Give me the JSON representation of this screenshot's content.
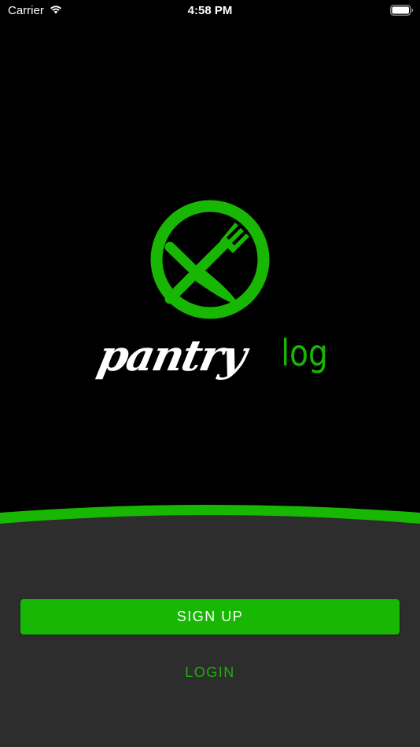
{
  "status_bar": {
    "carrier": "Carrier",
    "time": "4:58 PM"
  },
  "logo": {
    "wordmark": "pantrylog",
    "wordmark_primary": "pantry",
    "wordmark_secondary": "log"
  },
  "actions": {
    "signup_label": "SIGN UP",
    "login_label": "LOGIN"
  },
  "colors": {
    "brand_green": "#17b704",
    "background": "#000000",
    "panel": "#2d2d2d",
    "text": "#ffffff"
  }
}
